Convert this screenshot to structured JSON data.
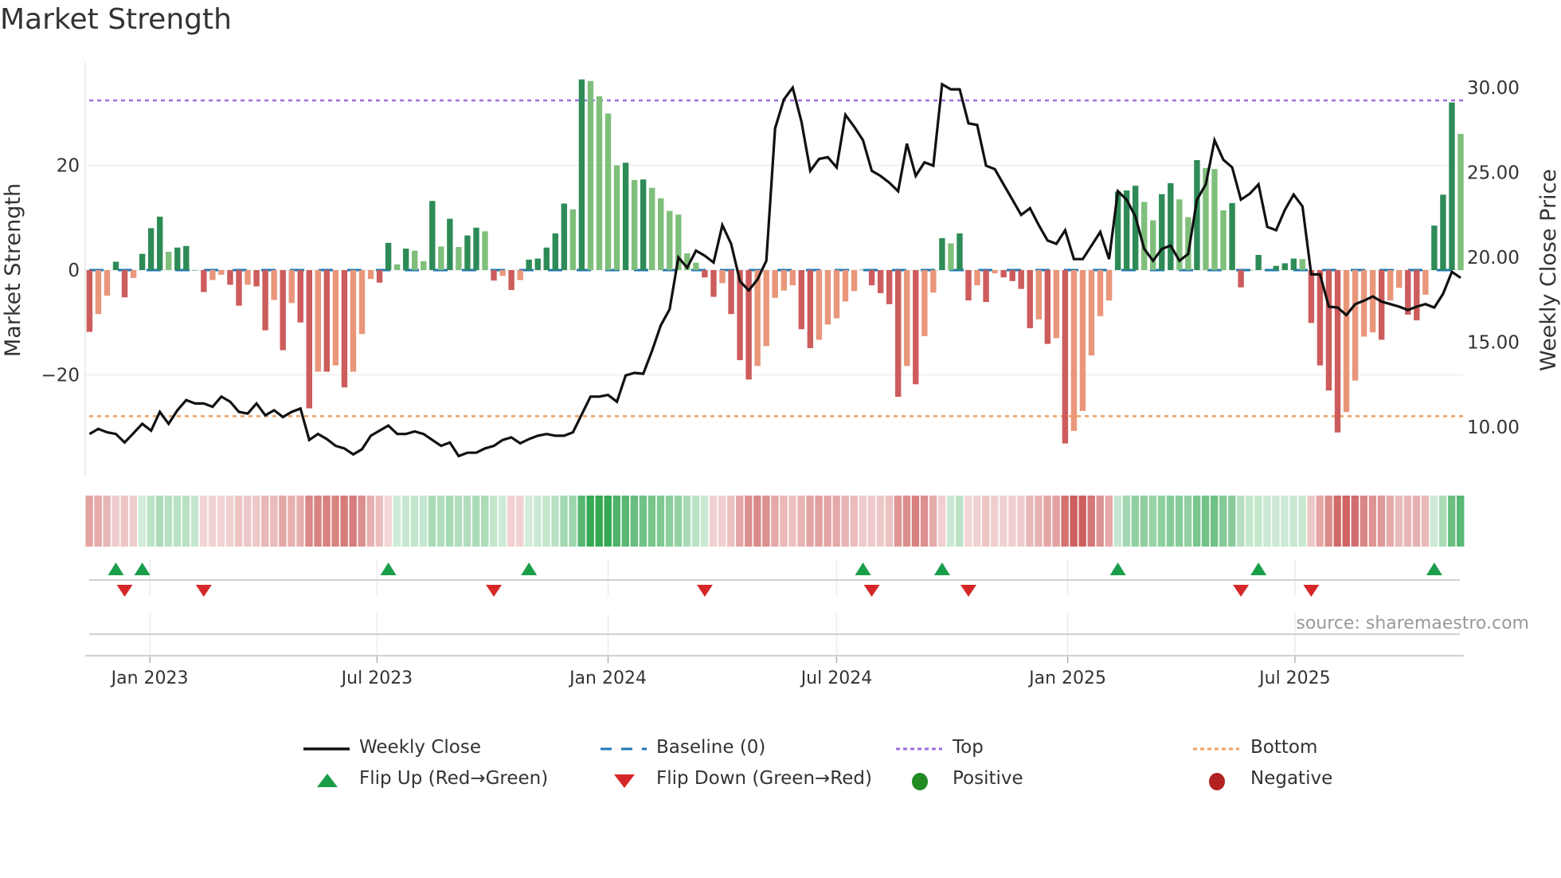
{
  "title": "Market Strength",
  "source": "source: sharemaestro.com",
  "legend": {
    "weekly_close": "Weekly Close",
    "baseline": "Baseline (0)",
    "top": "Top",
    "bottom": "Bottom",
    "flip_up": "Flip Up (Red→Green)",
    "flip_down": "Flip Down (Green→Red)",
    "positive": "Positive",
    "negative": "Negative"
  },
  "colors": {
    "pos_strong": "#2e8b57",
    "pos_weak": "#7fbf7b",
    "neg_strong": "#cd5c5c",
    "neg_weak": "#e9967a",
    "price": "#111111",
    "baseline": "#1f77b4",
    "top": "#9d6ee0",
    "bottom": "#f0a060",
    "flip_up": "#1a9e4a",
    "flip_down": "#d62728",
    "positive": "#228b22",
    "negative": "#b22222",
    "heat_pos": "#34a853",
    "heat_neg": "#c8504f"
  },
  "chart_data": {
    "type": "bar",
    "title": "Market Strength",
    "ylabel": "Market Strength",
    "y2label": "Weekly Close Price",
    "start_week": "2022-11-14",
    "frequency": "weekly",
    "ylim": [
      -39.4,
      39.7
    ],
    "y2lim": [
      7.1,
      31.5
    ],
    "yticks": [
      {
        "v": 20,
        "label": "20"
      },
      {
        "v": 0,
        "label": "0"
      },
      {
        "v": -20,
        "label": "−20"
      }
    ],
    "y2ticks": [
      {
        "v": 30,
        "label": "30.00"
      },
      {
        "v": 25,
        "label": "25.00"
      },
      {
        "v": 20,
        "label": "20.00"
      },
      {
        "v": 15,
        "label": "15.00"
      },
      {
        "v": 10,
        "label": "10.00"
      }
    ],
    "xticks": [
      {
        "date": "2023-01-01",
        "label": "Jan 2023"
      },
      {
        "date": "2023-07-01",
        "label": "Jul 2023"
      },
      {
        "date": "2024-01-01",
        "label": "Jan 2024"
      },
      {
        "date": "2024-07-01",
        "label": "Jul 2024"
      },
      {
        "date": "2025-01-01",
        "label": "Jan 2025"
      },
      {
        "date": "2025-07-01",
        "label": "Jul 2025"
      }
    ],
    "top_level": 32.4,
    "bottom_level": -27.9,
    "baseline": 0,
    "strength": [
      -11.8,
      -8.4,
      -4.9,
      1.6,
      -5.2,
      -1.5,
      3.1,
      8.0,
      10.2,
      3.5,
      4.3,
      4.6,
      0,
      -4.2,
      -1.9,
      -0.9,
      -2.8,
      -6.8,
      -2.8,
      -3.1,
      -11.5,
      -5.7,
      -15.3,
      -6.3,
      -10.0,
      -26.4,
      -19.4,
      -19.4,
      -18.2,
      -22.4,
      -19.4,
      -12.2,
      -1.7,
      -2.4,
      5.2,
      1.1,
      4.1,
      3.7,
      1.7,
      13.2,
      4.5,
      9.8,
      4.4,
      6.6,
      8.1,
      7.4,
      -2.0,
      -1.1,
      -3.8,
      -1.9,
      2.0,
      2.2,
      4.3,
      7.0,
      12.7,
      11.6,
      36.4,
      36.1,
      33.2,
      29.9,
      20.0,
      20.5,
      17.2,
      17.3,
      15.7,
      13.7,
      11.3,
      10.6,
      3.2,
      1.4,
      -1.4,
      -5.1,
      -2.5,
      -8.4,
      -17.2,
      -20.9,
      -18.3,
      -14.5,
      -5.3,
      -3.9,
      -2.9,
      -11.3,
      -14.9,
      -13.3,
      -10.4,
      -9.2,
      -6.0,
      -4.0,
      0.1,
      -2.9,
      -4.4,
      -6.5,
      -24.2,
      -18.3,
      -21.8,
      -12.6,
      -4.3,
      6.1,
      5.1,
      7.0,
      -5.8,
      -2.9,
      -6.1,
      -0.6,
      -1.4,
      -2.1,
      -3.6,
      -11.1,
      -9.4,
      -14.1,
      -13.0,
      -33.1,
      -30.7,
      -26.9,
      -16.3,
      -8.8,
      -5.8,
      15.0,
      15.2,
      16.1,
      13.0,
      9.5,
      14.5,
      16.6,
      13.5,
      10.1,
      21.0,
      19.5,
      19.3,
      11.4,
      12.8,
      -3.3,
      0,
      2.9,
      0,
      0.8,
      1.3,
      2.2,
      2.1,
      -10.1,
      -18.2,
      -23.0,
      -31.0,
      -27.1,
      -21.1,
      -12.7,
      -11.9,
      -13.3,
      -5.8,
      -3.4,
      -8.5,
      -9.6,
      -4.7,
      8.5,
      14.4,
      32.0,
      26.0
    ],
    "weekly_close": [
      9.6,
      9.9,
      9.7,
      9.6,
      9.1,
      9.65,
      10.2,
      9.8,
      10.9,
      10.2,
      11.0,
      11.6,
      11.4,
      11.4,
      11.2,
      11.8,
      11.5,
      10.9,
      10.8,
      11.4,
      10.7,
      11.0,
      10.6,
      10.9,
      11.1,
      9.25,
      9.6,
      9.3,
      8.9,
      8.75,
      8.4,
      8.7,
      9.5,
      9.8,
      10.1,
      9.6,
      9.6,
      9.75,
      9.6,
      9.25,
      8.9,
      9.1,
      8.3,
      8.5,
      8.5,
      8.75,
      8.9,
      9.25,
      9.4,
      9.05,
      9.3,
      9.5,
      9.6,
      9.5,
      9.5,
      9.7,
      10.75,
      11.8,
      11.8,
      11.9,
      11.5,
      13.05,
      13.2,
      13.15,
      14.5,
      16.0,
      16.95,
      20.0,
      19.4,
      20.4,
      20.1,
      19.7,
      21.9,
      20.8,
      18.6,
      18.05,
      18.7,
      19.8,
      27.6,
      29.3,
      30.0,
      28.0,
      25.1,
      25.8,
      25.9,
      25.3,
      28.4,
      27.7,
      26.9,
      25.1,
      24.8,
      24.4,
      23.9,
      26.7,
      24.8,
      25.6,
      25.4,
      30.2,
      29.9,
      29.9,
      27.9,
      27.8,
      25.4,
      25.2,
      24.3,
      23.4,
      22.5,
      22.9,
      21.9,
      21.0,
      20.8,
      21.6,
      19.9,
      19.9,
      20.7,
      21.5,
      19.9,
      23.9,
      23.4,
      22.4,
      20.5,
      19.8,
      20.5,
      20.7,
      19.8,
      20.2,
      23.4,
      24.3,
      26.9,
      25.75,
      25.3,
      23.4,
      23.75,
      24.3,
      21.8,
      21.6,
      22.8,
      23.7,
      23.0,
      19.0,
      19.0,
      17.1,
      17.05,
      16.6,
      17.25,
      17.45,
      17.7,
      17.4,
      17.25,
      17.1,
      16.9,
      17.1,
      17.25,
      17.05,
      17.85,
      19.15,
      18.8
    ],
    "flip_up_weeks": [
      3,
      6,
      34,
      50,
      88,
      97,
      117,
      133,
      153
    ],
    "flip_down_weeks": [
      4,
      13,
      46,
      70,
      89,
      100,
      131,
      139
    ]
  }
}
